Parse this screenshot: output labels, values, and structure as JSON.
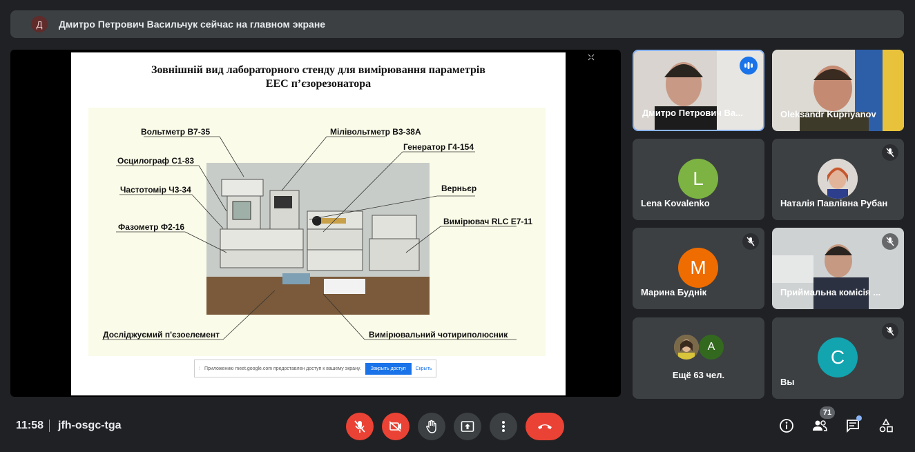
{
  "banner": {
    "avatar_letter": "Д",
    "text": "Дмитро Петрович Васильчук сейчас на главном экране"
  },
  "slide": {
    "title_line1": "Зовнішній вид лабораторного стенду для вимірювання параметрів",
    "title_line2": "ЕЕС п’єзорезонатора",
    "labels": {
      "voltmeter": "Вольтметр В7-35",
      "millivoltmeter": "Мілівольтметр В3-38А",
      "generator": "Генератор Г4-154",
      "oscillograph": "Осцилограф С1-83",
      "frequency_meter": "Частотомір Ч3-34",
      "vernier": "Верньєр",
      "phase_meter": "Фазометр Ф2-16",
      "rlc_meter": "Вимірювач RLC Е7-11",
      "piezo_element": "Досліджуємий п'єзоелемент",
      "four_terminal": "Вимірювальний чотириполюсник"
    },
    "share_bar": {
      "text": "Приложению meet.google.com предоставлен доступ к вашему экрану.",
      "stop_label": "Закрыть доступ",
      "hide_label": "Скрыть"
    }
  },
  "participants": [
    {
      "name": "Дмитро Петрович Ва...",
      "type": "video"
    },
    {
      "name": "Oleksandr Kupriyanov",
      "type": "video"
    },
    {
      "name": "Lena Kovalenko",
      "letter": "L",
      "color": "#7cb342",
      "type": "avatar"
    },
    {
      "name": "Наталія Павлівна Рубан",
      "type": "photo",
      "muted": true
    },
    {
      "name": "Марина Буднік",
      "letter": "M",
      "color": "#ef6c00",
      "type": "avatar",
      "muted": true
    },
    {
      "name": "Приймальна комісія ...",
      "type": "video",
      "muted": true
    },
    {
      "name": "Ещё 63 чел.",
      "letter": "A",
      "color": "#33691e",
      "type": "more"
    },
    {
      "name": "Вы",
      "letter": "C",
      "color": "#12a4af",
      "type": "avatar",
      "muted": true
    }
  ],
  "bottom": {
    "time": "11:58",
    "meeting_code": "jfh-osgc-tga",
    "participants_count": "71"
  },
  "colors": {
    "background": "#202124",
    "tile": "#3c4043",
    "danger": "#ea4335",
    "accent": "#1a73e8"
  }
}
